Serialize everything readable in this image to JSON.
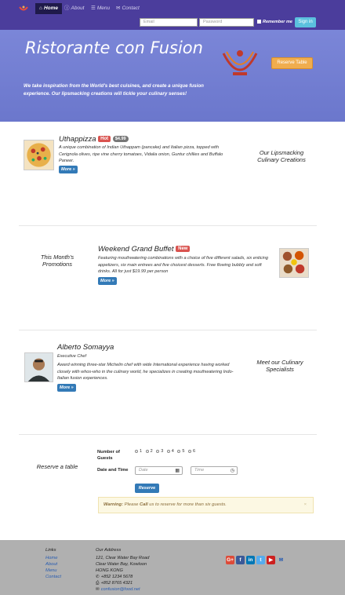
{
  "navbar": {
    "home": "Home",
    "about": "About",
    "menu": "Menu",
    "contact": "Contact",
    "email_placeholder": "Email",
    "password_placeholder": "Password",
    "remember_me": "Remember me",
    "sign_in": "Sign in"
  },
  "jumbotron": {
    "title": "Ristorante con Fusion",
    "text": "We take inspiration from the World's best cuisines, and create a unique fusion experience. Our lipsmacking creations will tickle your culinary senses!",
    "reserve_button": "Reserve Table"
  },
  "dish": {
    "name": "Uthappizza",
    "label": "Hot",
    "price": "$4.99",
    "description": "A unique combination of Indian Uthappam (pancake) and Italian pizza, topped with Cerignola olives, ripe vine cherry tomatoes, Vidalia onion, Guntur chillies and Buffalo Paneer.",
    "more": "More »",
    "side_title": "Our Lipsmacking Culinary Creations"
  },
  "promotion": {
    "side_title": "This Month's Promotions",
    "name": "Weekend Grand Buffet",
    "label": "New",
    "description": "Featuring mouthwatering combinations with a choice of five different salads, six enticing appetizers, six main entrees and five choicest desserts. Free flowing bubbly and soft drinks. All for just $19.99 per person",
    "more": "More »"
  },
  "leader": {
    "name": "Alberto Somayya",
    "designation": "Executive Chef",
    "description": "Award winning three-star Michelin chef with wide International experience having worked closely with whos-who in the culinary world, he specializes in creating mouthwatering Indo-Italian fusion experiences.",
    "more": "More »",
    "side_title": "Meet our Culinary Specialists"
  },
  "reservation": {
    "side_title": "Reserve a table",
    "guests_label": "Number of Guests",
    "guest_options": [
      "1",
      "2",
      "3",
      "4",
      "5",
      "6"
    ],
    "datetime_label": "Date and Time",
    "date_placeholder": "Date",
    "time_placeholder": "Time",
    "reserve_button": "Reserve",
    "warning_prefix": "Warning:",
    "warning_text": "Please",
    "warning_bold": "Call",
    "warning_rest": "us to reserve for more than six guests.",
    "warning_close": "×"
  },
  "footer": {
    "links_title": "Links",
    "links": [
      "Home",
      "About",
      "Menu",
      "Contact"
    ],
    "address_title": "Our Address",
    "address": [
      "121, Clear Water Bay Road",
      "Clear Water Bay, Kowloon",
      "HONG KONG"
    ],
    "phone": "+852 1234 5678",
    "fax": "+852 8765 4321",
    "email": "confusion@food.net",
    "social": [
      "google-plus",
      "facebook",
      "linkedin",
      "twitter",
      "youtube",
      "mail"
    ]
  },
  "colors": {
    "navbar": "#4b3d9c",
    "jumbotron": "#7b86d8",
    "primary": "#337ab7",
    "warning": "#f0ad4e",
    "danger": "#d9534f",
    "info": "#5bc0de",
    "footer": "#b0b0b0"
  }
}
